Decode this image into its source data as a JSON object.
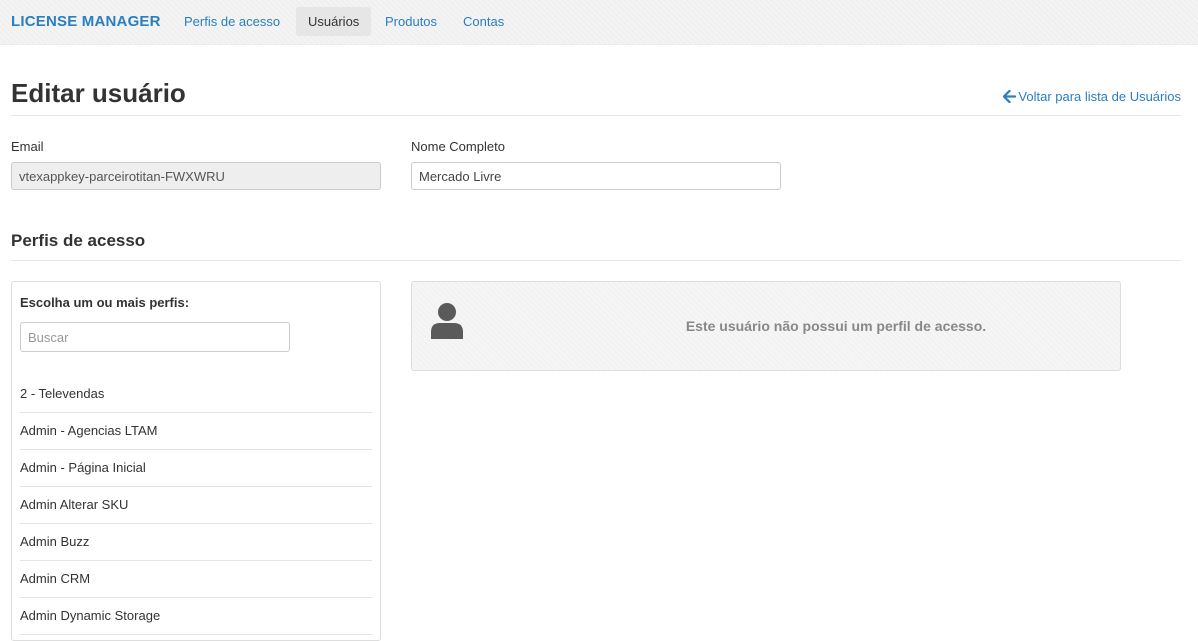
{
  "navbar": {
    "brand": "LICENSE MANAGER",
    "links": [
      {
        "label": "Perfis de acesso",
        "active": false
      },
      {
        "label": "Usuários",
        "active": true
      },
      {
        "label": "Produtos",
        "active": false
      },
      {
        "label": "Contas",
        "active": false
      }
    ]
  },
  "page": {
    "title": "Editar usuário",
    "back_link": "Voltar para lista de Usuários",
    "back_icon": "arrow-left-icon"
  },
  "form": {
    "email_label": "Email",
    "email_value": "vtexappkey-parceirotitan-FWXWRU",
    "name_label": "Nome Completo",
    "name_value": "Mercado Livre"
  },
  "profiles": {
    "section_title": "Perfis de acesso",
    "chooser_heading": "Escolha um ou mais perfis:",
    "search_placeholder": "Buscar",
    "items": [
      "2 - Televendas",
      "Admin - Agencias LTAM",
      "Admin - Página Inicial",
      "Admin Alterar SKU",
      "Admin Buzz",
      "Admin CRM",
      "Admin Dynamic Storage"
    ],
    "empty_message": "Este usuário não possui um perfil de acesso.",
    "empty_icon": "user-icon"
  },
  "colors": {
    "link": "#2a7fc1",
    "text": "#333333",
    "muted": "#888888"
  }
}
